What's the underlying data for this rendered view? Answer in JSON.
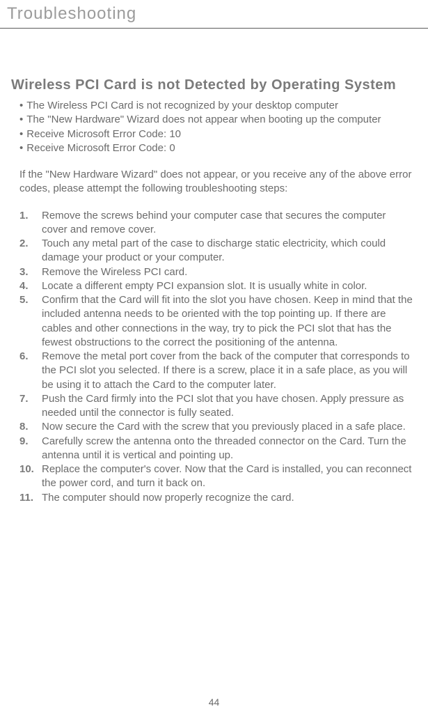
{
  "header": {
    "title": "Troubleshooting"
  },
  "section": {
    "title": "Wireless PCI Card is not Detected by Operating System"
  },
  "bullets": [
    "The Wireless PCI Card is not recognized by your desktop computer",
    "The \"New Hardware\" Wizard does not appear when booting up the computer",
    "Receive Microsoft Error Code: 10",
    "Receive Microsoft Error Code: 0"
  ],
  "intro": "If the \"New Hardware Wizard\" does not appear, or you receive any of the above error codes, please attempt the following troubleshooting steps:",
  "steps": [
    {
      "num": "1.",
      "text": "Remove the screws behind your computer case that secures the computer cover and remove cover."
    },
    {
      "num": "2.",
      "text": "Touch any metal part of the case to discharge static electricity, which could damage your product or your computer."
    },
    {
      "num": "3.",
      "text": "Remove the Wireless PCI card."
    },
    {
      "num": "4.",
      "text": "Locate a different empty PCI expansion slot. It is usually white in color."
    },
    {
      "num": "5.",
      "text": "Confirm that the Card will fit into the slot you have chosen. Keep in mind that the included antenna needs to be oriented with the top pointing up. If there are cables and other connections in the way, try to pick the PCI slot that has the fewest obstructions to the correct the positioning of the antenna."
    },
    {
      "num": "6.",
      "text": "Remove the metal port cover from the back of the computer that corresponds to the PCI slot you selected. If there is a screw, place it in a safe place, as you will be using it to attach the Card to the computer later."
    },
    {
      "num": "7.",
      "text": "Push the Card firmly into the PCI slot that you have chosen. Apply pressure as needed until the connector is fully seated."
    },
    {
      "num": "8.",
      "text": "Now secure the Card with the screw that you previously placed in a safe place."
    },
    {
      "num": "9.",
      "text": "Carefully screw the antenna onto the threaded connector on the Card. Turn the antenna until it is vertical and pointing up."
    },
    {
      "num": "10.",
      "text": "Replace the computer's cover. Now that the Card is installed, you can reconnect the power cord, and turn it back on."
    },
    {
      "num": "11.",
      "text": "The computer should now properly recognize the card."
    }
  ],
  "footer": {
    "page_number": "44"
  }
}
